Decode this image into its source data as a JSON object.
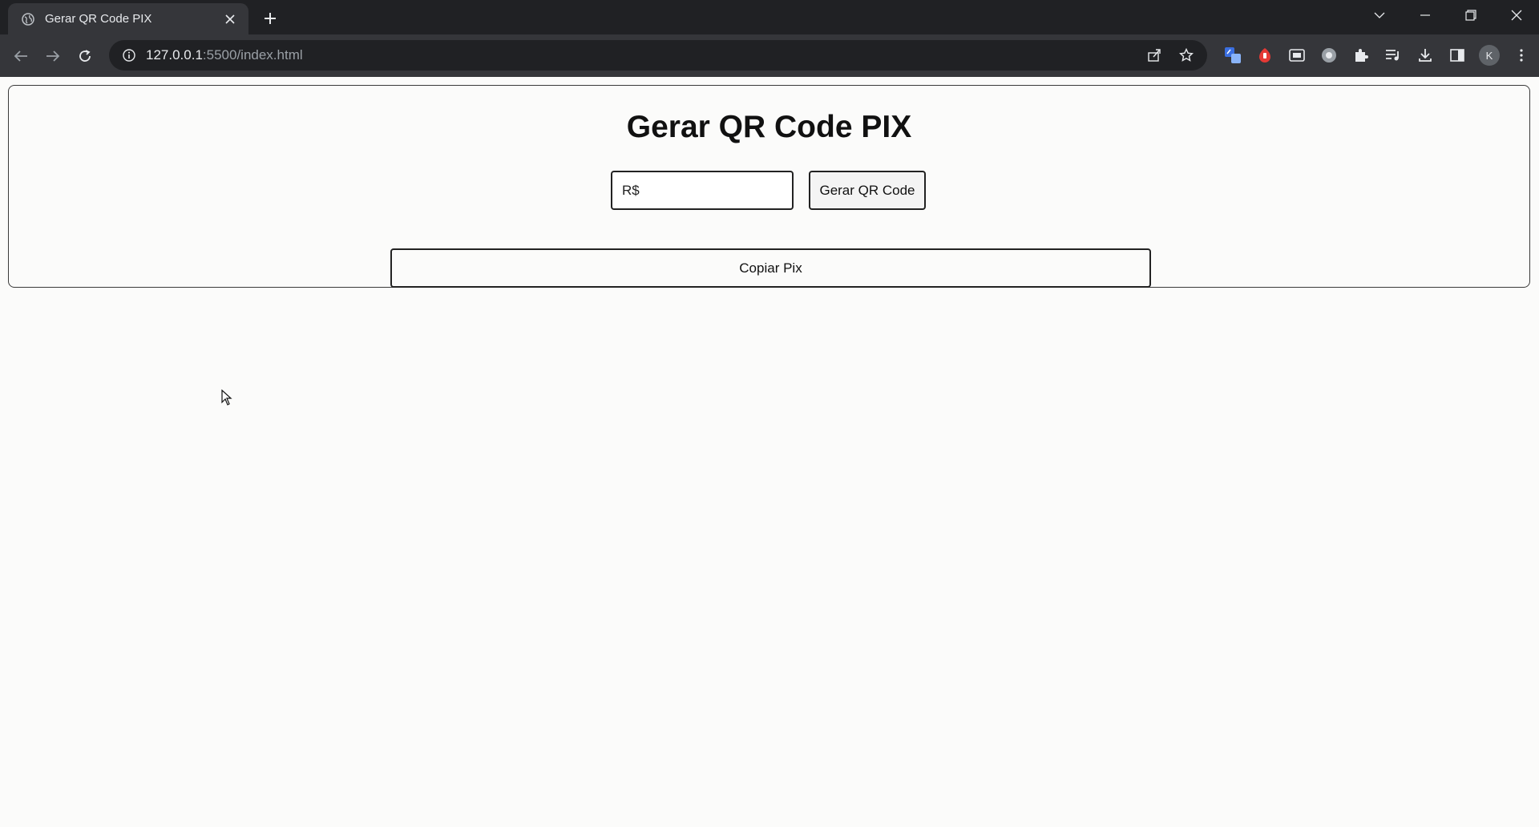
{
  "browser": {
    "tab": {
      "title": "Gerar QR Code PIX",
      "favicon": "globe-icon",
      "close_icon": "close-icon"
    },
    "new_tab_icon": "plus-icon",
    "address_bar": {
      "url_host": "127.0.0.1",
      "url_path": ":5500/index.html",
      "info_icon": "info-icon"
    },
    "profile_initial": "K",
    "colors": {
      "chrome_dark": "#202124",
      "chrome_mid": "#35363a",
      "text": "#e8eaed",
      "text_dim": "#9aa0a6"
    }
  },
  "page": {
    "title": "Gerar QR Code PIX",
    "value_input": {
      "placeholder": "R$",
      "value": ""
    },
    "generate_button_label": "Gerar QR Code",
    "copy_button_label": "Copiar Pix"
  }
}
